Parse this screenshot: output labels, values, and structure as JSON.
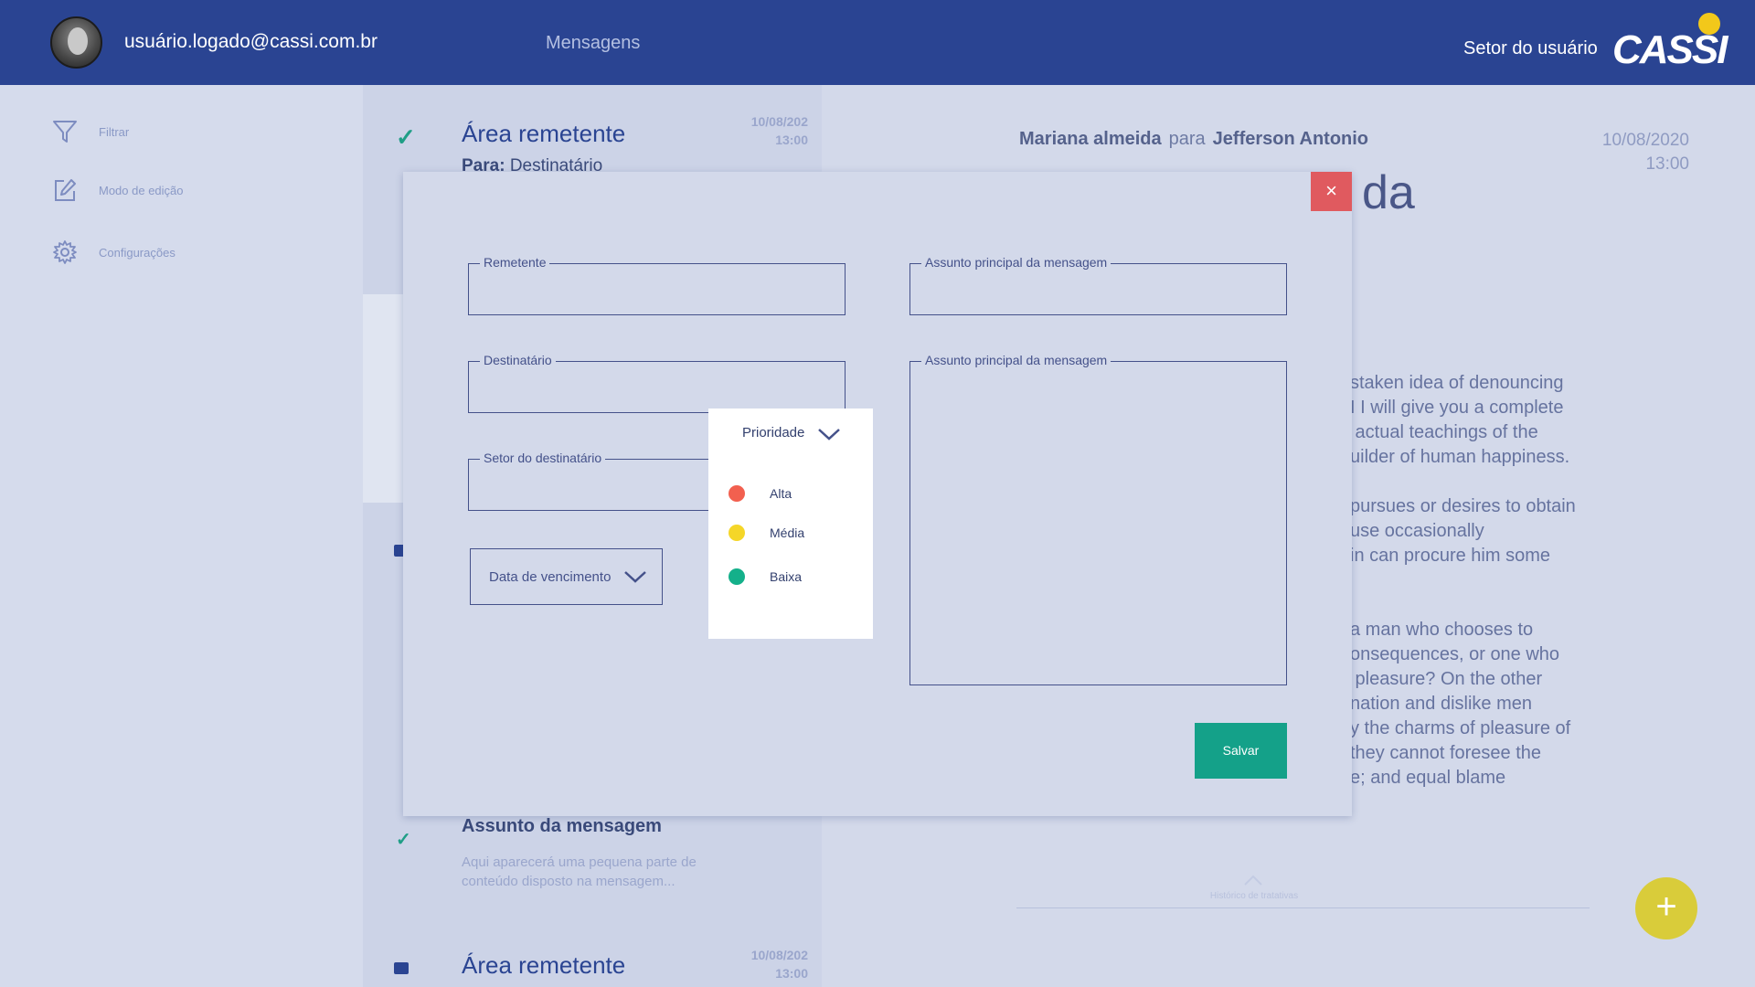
{
  "header": {
    "user_email": "usuário.logado@cassi.com.br",
    "nav_messages": "Mensagens",
    "user_sector": "Setor do usuário",
    "logo_text": "CASSI",
    "brand_color": "#2a4492"
  },
  "sidebar": {
    "items": [
      {
        "label": "Filtrar",
        "icon": "filter-icon"
      },
      {
        "label": "Modo de edição",
        "icon": "edit-icon"
      },
      {
        "label": "Configurações",
        "icon": "gear-icon"
      }
    ]
  },
  "list": {
    "items": [
      {
        "sender": "Área remetente",
        "to_label": "Para:",
        "to_value": "Destinatário",
        "date": "10/08/202",
        "time": "13:00"
      },
      {
        "subject": "Assunto da mensagem",
        "preview": "Aqui aparecerá uma pequena parte de conteúdo disposto na mensagem..."
      },
      {
        "sender": "Área remetente",
        "date": "10/08/202",
        "time": "13:00"
      }
    ]
  },
  "reader": {
    "from": "Mariana almeida",
    "para": "para",
    "to": "Jefferson Antonio",
    "date": "10/08/2020",
    "time": "13:00",
    "title_fragment": "da",
    "paragraph1": "staken idea of denouncing\nI I will give you a complete\n actual teachings of the\nuilder of human happiness.",
    "paragraph2": "pursues or desires to obtain\nuse occasionally\nin can procure him some",
    "paragraph3": "a man who chooses to\nonsequences, or one who\n pleasure? On the other\nnation and dislike men\ny the charms of pleasure of\nthey cannot foresee the\ne; and equal blame",
    "history_label": "Histórico de tratativas"
  },
  "modal": {
    "close_label": "×",
    "remetente_label": "Remetente",
    "destinatario_label": "Destinatário",
    "setor_label": "Setor do destinatário",
    "assunto_label": "Assunto principal da mensagem",
    "mensagem_label": "Assunto principal da mensagem",
    "vencimento_label": "Data de vencimento",
    "priority": {
      "heading": "Prioridade",
      "options": [
        {
          "label": "Alta",
          "color": "#f2604f"
        },
        {
          "label": "Média",
          "color": "#f5d628"
        },
        {
          "label": "Baixa",
          "color": "#14b08a"
        }
      ]
    },
    "save_label": "Salvar",
    "save_color": "#14a189"
  },
  "fab": {
    "label": "+",
    "color": "#d9cc3a"
  }
}
